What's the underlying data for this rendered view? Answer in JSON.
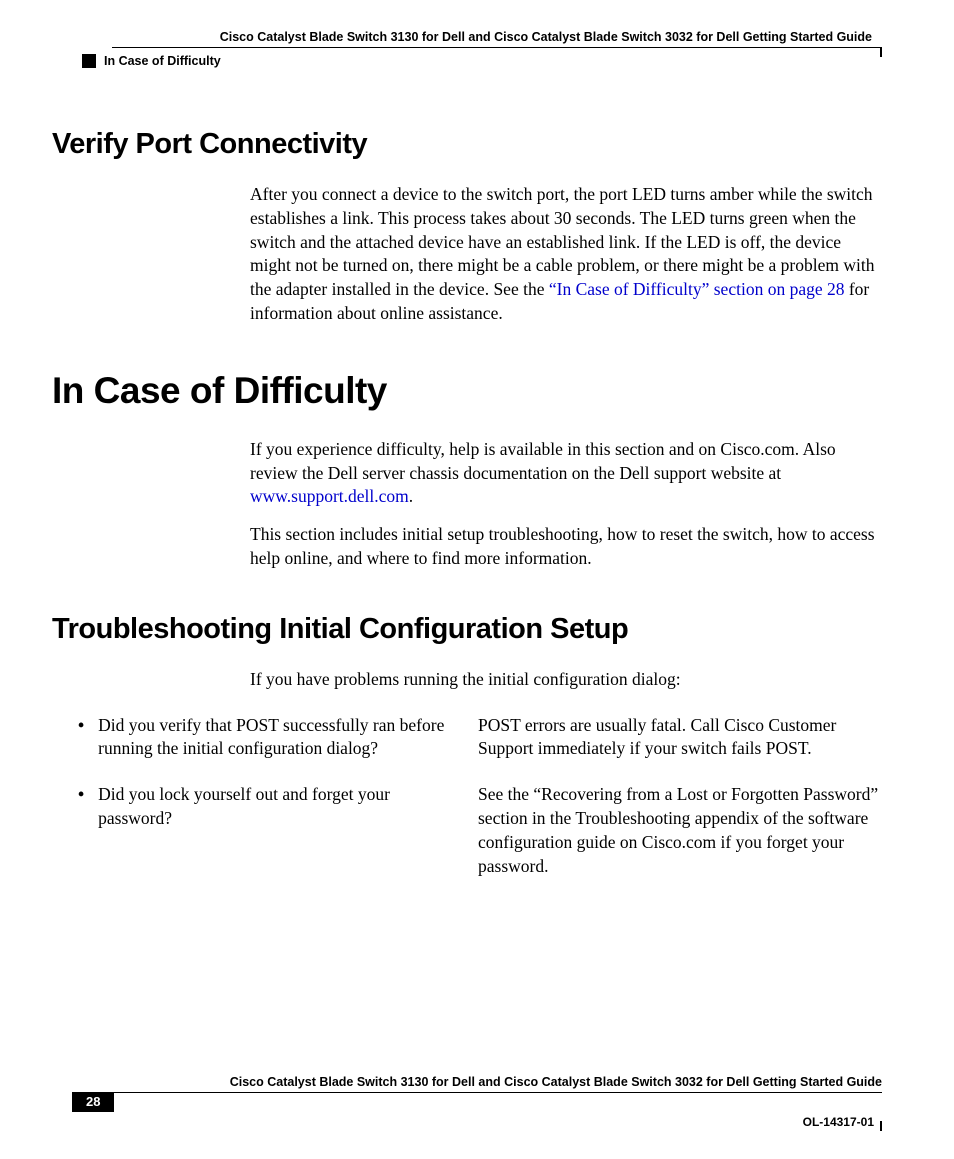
{
  "header": {
    "title": "Cisco Catalyst Blade Switch 3130 for Dell and Cisco Catalyst Blade Switch 3032 for Dell Getting Started Guide",
    "section": "In Case of Difficulty"
  },
  "sections": {
    "verify_port": {
      "heading": "Verify Port Connectivity",
      "para_part1": "After you connect a device to the switch port, the port LED turns amber while the switch establishes a link. This process takes about 30 seconds. The LED turns green when the switch and the attached device have an established link. If the LED is off, the device might not be turned on, there might be a cable problem, or there might be a problem with the adapter installed in the device. See the ",
      "link": "“In Case of Difficulty” section on page 28",
      "para_part2": " for information about online assistance."
    },
    "in_case": {
      "heading": "In Case of Difficulty",
      "para1_part1": "If you experience difficulty, help is available in this section and on Cisco.com. Also review the Dell server chassis documentation on the Dell support website at ",
      "link": "www.support.dell.com",
      "para1_part2": ".",
      "para2": "This section includes initial setup troubleshooting, how to reset the switch, how to access help online, and where to find more information."
    },
    "troubleshoot": {
      "heading": "Troubleshooting Initial Configuration Setup",
      "intro": "If you have problems running the initial configuration dialog:",
      "rows": [
        {
          "q": "Did you verify that POST successfully ran before running the initial configuration dialog?",
          "a": "POST errors are usually fatal. Call Cisco Customer Support immediately if your switch fails POST."
        },
        {
          "q": "Did you lock yourself out and forget your password?",
          "a": "See the “Recovering from a Lost or Forgotten Password” section in the Troubleshooting appendix of the software configuration guide on Cisco.com if you forget your password."
        }
      ]
    }
  },
  "footer": {
    "title": "Cisco Catalyst Blade Switch 3130 for Dell and Cisco Catalyst Blade Switch 3032 for Dell Getting Started Guide",
    "page": "28",
    "doc_id": "OL-14317-01"
  }
}
